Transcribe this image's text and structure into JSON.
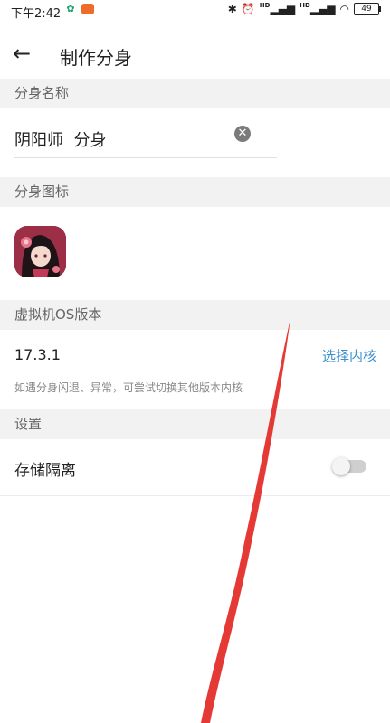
{
  "status_bar": {
    "time": "下午2:42",
    "hd_label": "HD",
    "battery": "49",
    "icons": [
      "notification-icon",
      "app-notification-icon",
      "bluetooth-icon",
      "alarm-icon",
      "signal-icon",
      "signal-icon",
      "wifi-icon",
      "battery-icon"
    ]
  },
  "app_bar": {
    "title": "制作分身"
  },
  "name_section": {
    "header": "分身名称",
    "value": "阴阳师  分身"
  },
  "icon_section": {
    "header": "分身图标",
    "icon": "app-icon"
  },
  "os_section": {
    "header": "虚拟机OS版本",
    "version": "17.3.1",
    "choose_label": "选择内核",
    "hint": "如遇分身闪退、异常，可尝试切换其他版本内核"
  },
  "settings_section": {
    "header": "设置",
    "storage_isolation_label": "存储隔离",
    "storage_isolation_enabled": false
  },
  "colors": {
    "accent": "#3d8fcd",
    "section_bg": "#f2f2f2",
    "annotation": "#e53935"
  }
}
